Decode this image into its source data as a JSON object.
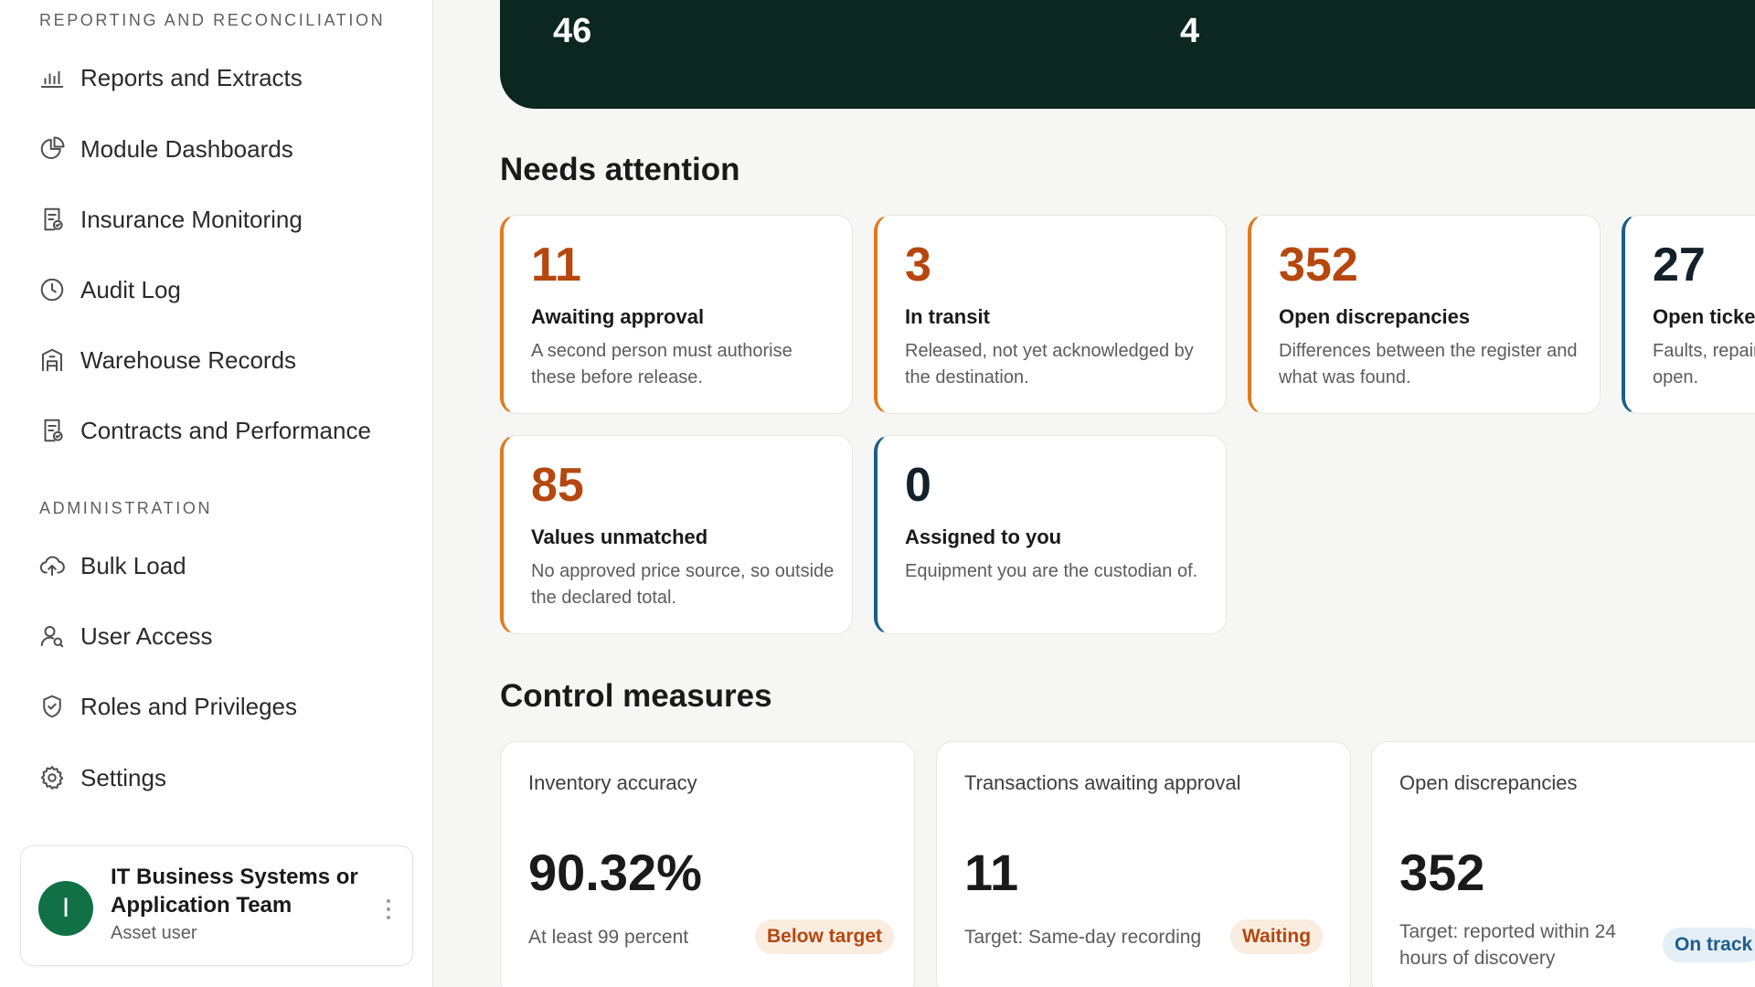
{
  "sidebar": {
    "sections": [
      {
        "label": "REPORTING AND RECONCILIATION",
        "items": [
          {
            "label": "Reports and Extracts",
            "icon": "bar-chart-icon"
          },
          {
            "label": "Module Dashboards",
            "icon": "pie-chart-icon"
          },
          {
            "label": "Insurance Monitoring",
            "icon": "document-check-icon"
          },
          {
            "label": "Audit Log",
            "icon": "clock-icon"
          },
          {
            "label": "Warehouse Records",
            "icon": "warehouse-icon"
          },
          {
            "label": "Contracts and Performance",
            "icon": "document-check-icon"
          }
        ]
      },
      {
        "label": "ADMINISTRATION",
        "items": [
          {
            "label": "Bulk Load",
            "icon": "cloud-upload-icon"
          },
          {
            "label": "User Access",
            "icon": "user-search-icon"
          },
          {
            "label": "Roles and Privileges",
            "icon": "shield-check-icon"
          },
          {
            "label": "Settings",
            "icon": "gear-icon"
          }
        ]
      }
    ],
    "user": {
      "initial": "I",
      "name": "IT Business Systems or Application Team",
      "role": "Asset user",
      "avatar_color": "#127046"
    }
  },
  "banner": {
    "values": [
      "46",
      "4"
    ]
  },
  "needs_attention": {
    "heading": "Needs attention",
    "cards": [
      {
        "value": "11",
        "title": "Awaiting approval",
        "description": "A second person must authorise these before release.",
        "accent": "#e07a1f"
      },
      {
        "value": "3",
        "title": "In transit",
        "description": "Released, not yet acknowledged by the destination.",
        "accent": "#e07a1f"
      },
      {
        "value": "352",
        "title": "Open discrepancies",
        "description": "Differences between the register and what was found.",
        "accent": "#e07a1f"
      },
      {
        "value": "27",
        "title": "Open tickets",
        "description": "Faults, repairs and claims still open.",
        "accent": "#1d5d8c"
      },
      {
        "value": "85",
        "title": "Values unmatched",
        "description": "No approved price source, so outside the declared total.",
        "accent": "#e07a1f"
      },
      {
        "value": "0",
        "title": "Assigned to you",
        "description": "Equipment you are the custodian of.",
        "accent": "#1d5d8c"
      }
    ]
  },
  "control_measures": {
    "heading": "Control measures",
    "cards": [
      {
        "title": "Inventory accuracy",
        "value": "90.32%",
        "target": "At least 99 percent",
        "status": "Below target"
      },
      {
        "title": "Transactions awaiting approval",
        "value": "11",
        "target": "Target: Same-day recording",
        "status": "Waiting"
      },
      {
        "title": "Open discrepancies",
        "value": "352",
        "target": "Target: reported within 24 hours of discovery",
        "status": "On track"
      }
    ]
  }
}
